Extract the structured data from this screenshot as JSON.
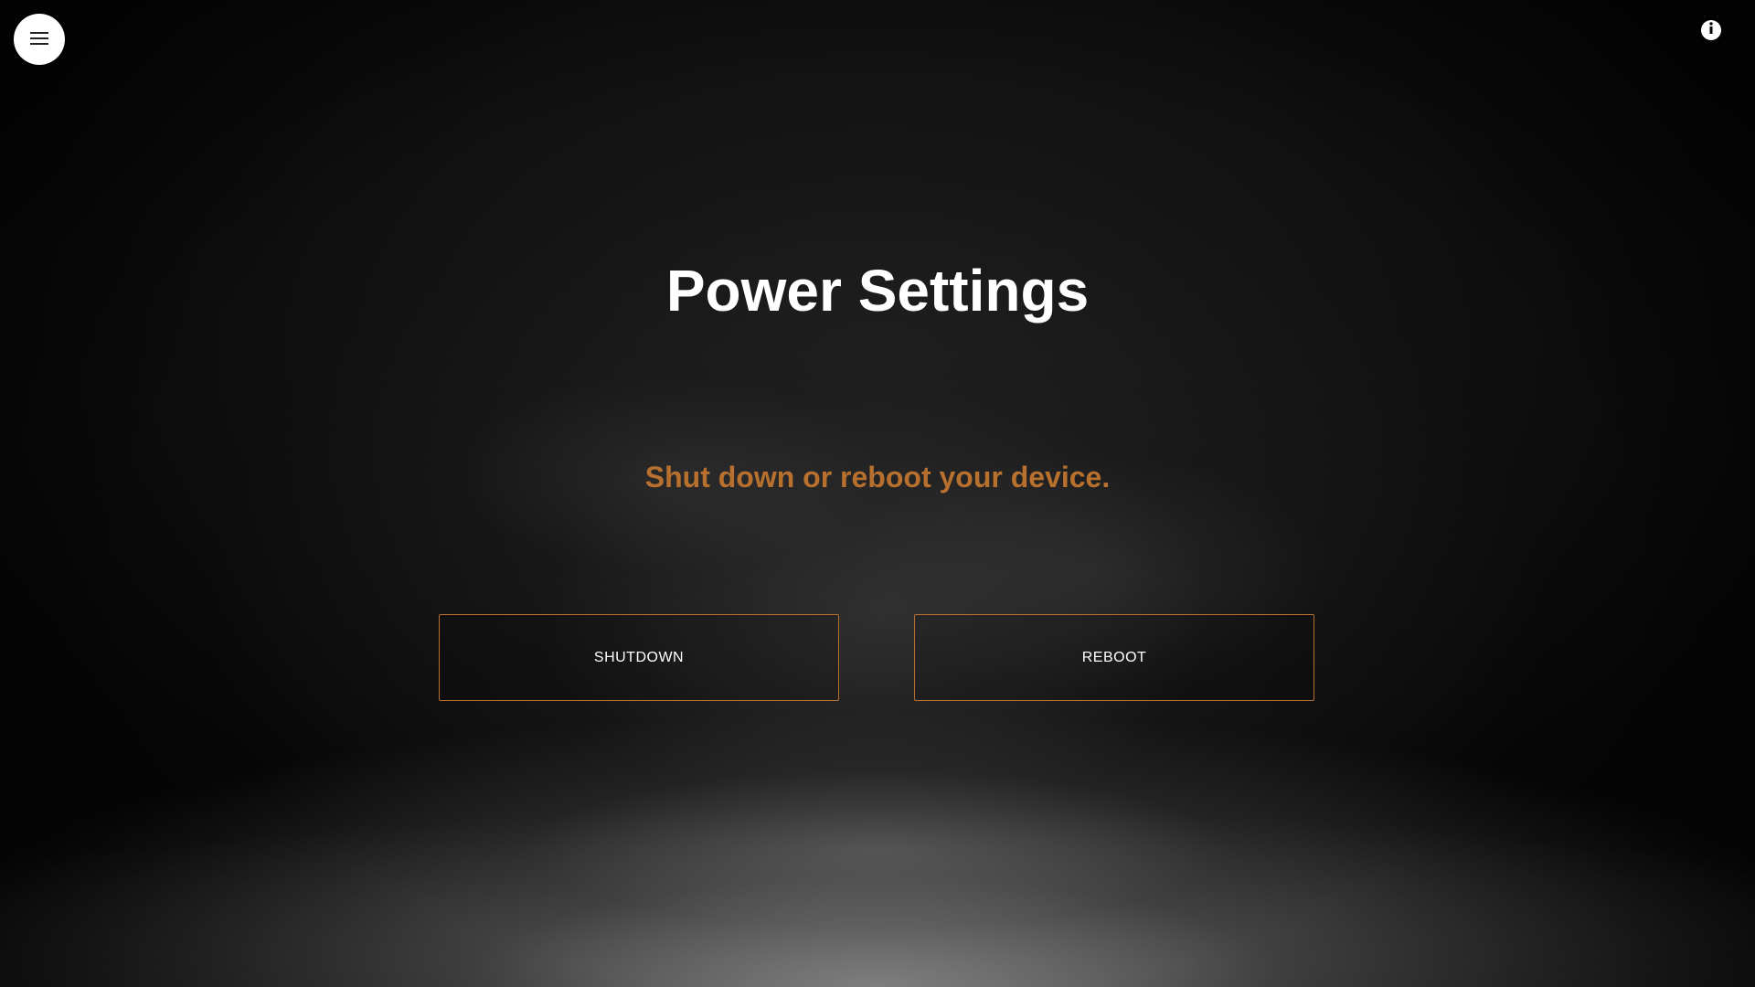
{
  "header": {
    "menu_icon": "hamburger-menu-icon",
    "info_icon": "info-icon"
  },
  "main": {
    "title": "Power Settings",
    "subtitle": "Shut down or reboot your device.",
    "shutdown_label": "SHUTDOWN",
    "reboot_label": "REBOOT"
  },
  "colors": {
    "accent": "#b8702e",
    "title": "#ffffff",
    "background": "#0a0a0a"
  }
}
